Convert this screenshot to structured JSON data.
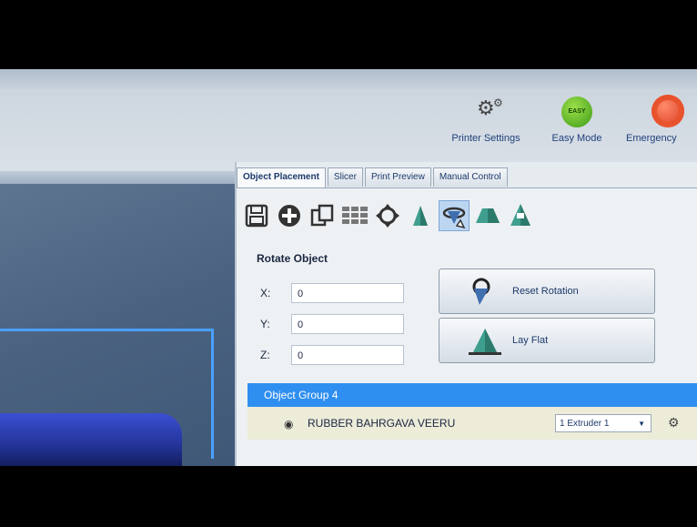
{
  "toolbar": {
    "printer_settings_label": "Printer Settings",
    "easy_mode_label": "Easy Mode",
    "easy_mode_badge": "EASY",
    "emergency_label": "Emergency"
  },
  "tabs": [
    {
      "label": "Object Placement",
      "active": true
    },
    {
      "label": "Slicer",
      "active": false
    },
    {
      "label": "Print Preview",
      "active": false
    },
    {
      "label": "Manual Control",
      "active": false
    }
  ],
  "tools": [
    "save-icon",
    "add-icon",
    "copy-icon",
    "grid-icon",
    "center-icon",
    "scale-icon",
    "rotate-icon",
    "mirror-icon",
    "cut-icon"
  ],
  "rotate": {
    "title": "Rotate Object",
    "x_label": "X:",
    "x_value": "0",
    "y_label": "Y:",
    "y_value": "0",
    "z_label": "Z:",
    "z_value": "0",
    "reset_label": "Reset Rotation",
    "lay_flat_label": "Lay Flat"
  },
  "objects": {
    "group_title": "Object Group 4",
    "item_name": "RUBBER BAHRGAVA VEERU",
    "extruder_value": "1 Extruder 1"
  },
  "colors": {
    "accent": "#2f8ff0",
    "viewport": "#4a6280",
    "selection_blue": "#4aa0ff",
    "object_blue": "#3b4fd2"
  }
}
